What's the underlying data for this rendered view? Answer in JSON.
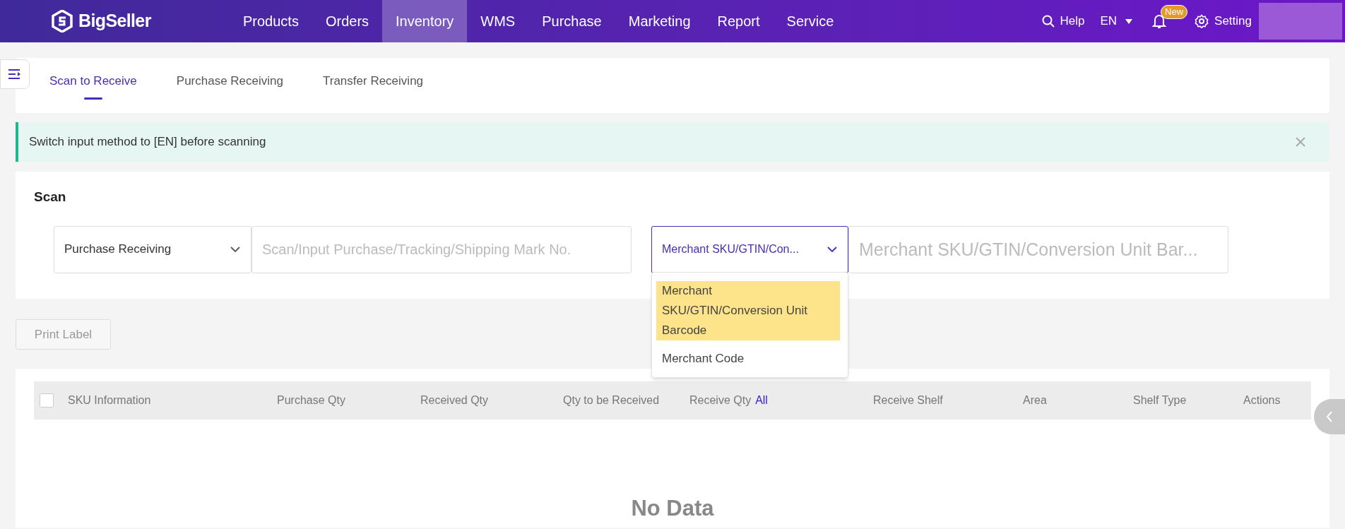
{
  "nav": {
    "logo": "BigSeller",
    "items": [
      {
        "label": "Products",
        "selected": false
      },
      {
        "label": "Orders",
        "selected": false
      },
      {
        "label": "Inventory",
        "selected": true
      },
      {
        "label": "WMS",
        "selected": false
      },
      {
        "label": "Purchase",
        "selected": false
      },
      {
        "label": "Marketing",
        "selected": false
      },
      {
        "label": "Report",
        "selected": false
      },
      {
        "label": "Service",
        "selected": false
      }
    ],
    "help": "Help",
    "language": "EN",
    "notification_badge": "New",
    "setting": "Setting"
  },
  "tabs": [
    {
      "label": "Scan to Receive",
      "selected": true
    },
    {
      "label": "Purchase Receiving",
      "selected": false
    },
    {
      "label": "Transfer Receiving",
      "selected": false
    }
  ],
  "notice": {
    "text": "Switch input method to [EN] before scanning"
  },
  "scan": {
    "title": "Scan",
    "type_select": {
      "value": "Purchase Receiving"
    },
    "order_input": {
      "placeholder": "Scan/Input Purchase/Tracking/Shipping Mark No."
    },
    "code_select": {
      "value": "Merchant SKU/GTIN/Con...",
      "expanded": true,
      "options": [
        {
          "label": "Merchant SKU/GTIN/Conversion Unit Barcode",
          "selected": true
        },
        {
          "label": "Merchant Code",
          "selected": false
        }
      ]
    },
    "code_input": {
      "placeholder": "Merchant SKU/GTIN/Conversion Unit Bar..."
    }
  },
  "print_label": "Print Label",
  "table": {
    "select_all_checked": false,
    "columns": [
      {
        "label": "SKU Information"
      },
      {
        "label": "Purchase Qty"
      },
      {
        "label": "Received Qty"
      },
      {
        "label": "Qty to be Received"
      },
      {
        "label": "Receive Qty",
        "link": "All"
      },
      {
        "label": "Receive Shelf"
      },
      {
        "label": "Area"
      },
      {
        "label": "Shelf Type"
      },
      {
        "label": "Actions"
      }
    ],
    "empty_text": "No Data"
  }
}
